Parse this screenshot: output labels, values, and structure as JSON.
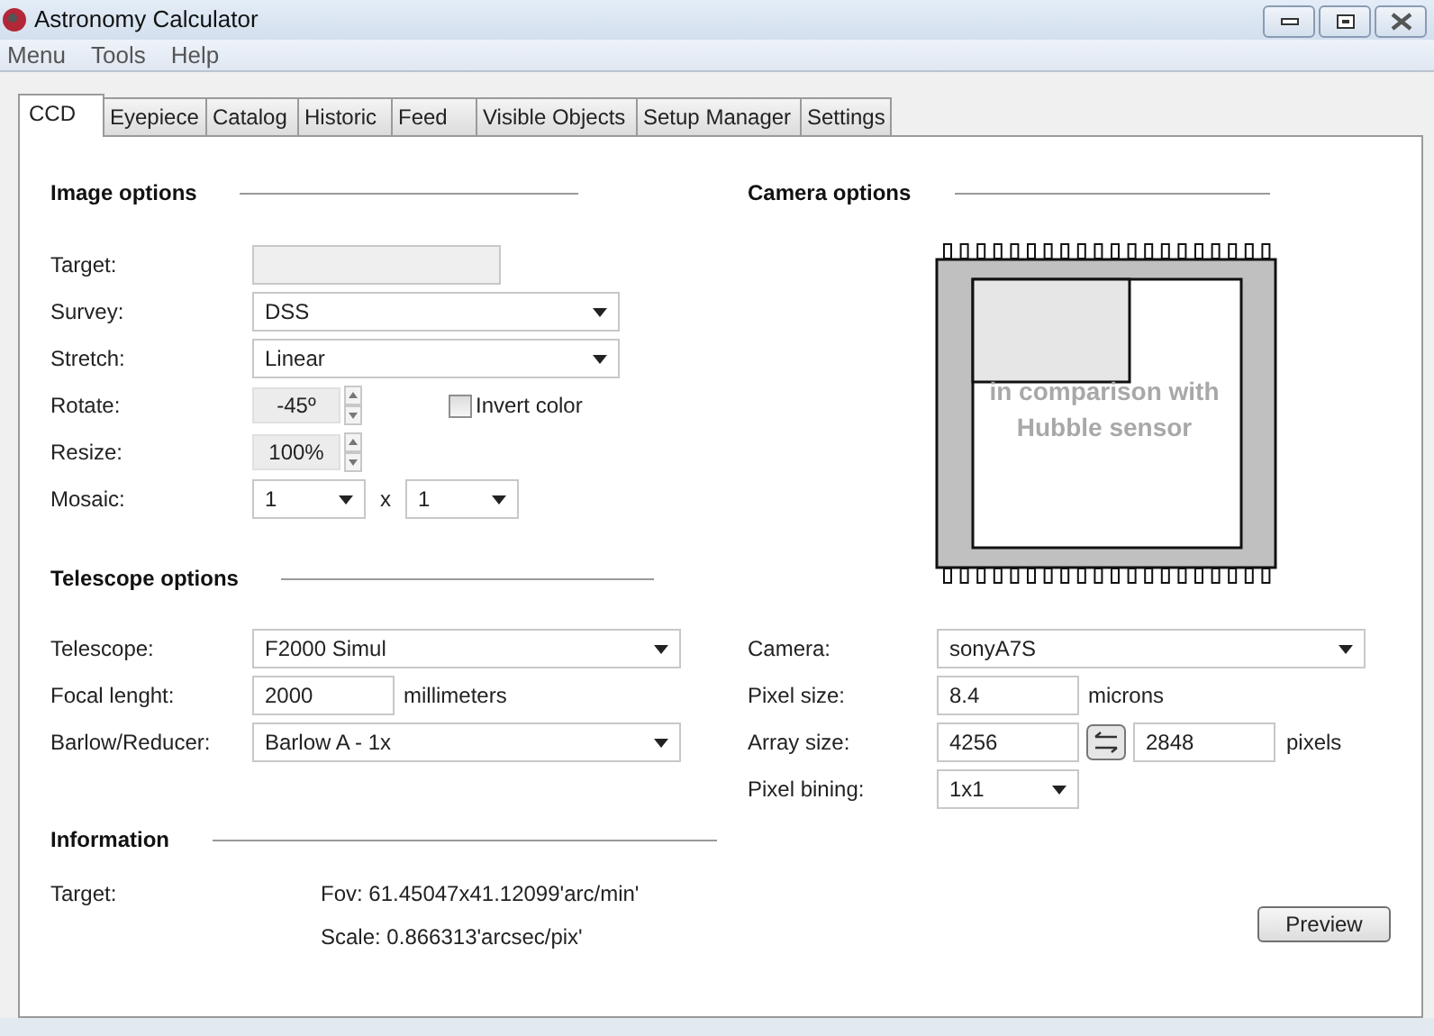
{
  "window": {
    "title": "Astronomy Calculator"
  },
  "menu": [
    "Menu",
    "Tools",
    "Help"
  ],
  "tabs": [
    {
      "label": "CCD",
      "selected": true
    },
    {
      "label": "Eyepiece",
      "selected": false
    },
    {
      "label": "Catalog",
      "selected": false
    },
    {
      "label": "Historic",
      "selected": false
    },
    {
      "label": "Feed",
      "selected": false
    },
    {
      "label": "Visible Objects",
      "selected": false
    },
    {
      "label": "Setup Manager",
      "selected": false
    },
    {
      "label": "Settings",
      "selected": false
    }
  ],
  "image_options": {
    "title": "Image options",
    "fields": [
      {
        "kind": "input",
        "label": "Target:",
        "disabled": true
      },
      {
        "kind": "select",
        "label": "Survey:",
        "value": "DSS"
      },
      {
        "kind": "select",
        "label": "Stretch:",
        "value": "Linear"
      },
      {
        "kind": "spinner",
        "label": "Rotate:",
        "value": "-45º",
        "checkbox": {
          "label": "Invert color",
          "checked": false
        }
      },
      {
        "kind": "spinner",
        "label": "Resize:",
        "value": "100%"
      },
      {
        "kind": "pair",
        "label": "Mosaic:",
        "values": [
          "1",
          "1"
        ],
        "separator": "x"
      }
    ]
  },
  "telescope_options": {
    "title": "Telescope options",
    "fields": [
      {
        "kind": "select",
        "label": "Telescope:",
        "value": "F2000 Simul"
      },
      {
        "kind": "measure",
        "label": "Focal lenght:",
        "value": "2000",
        "unit": "millimeters"
      },
      {
        "kind": "select",
        "label": "Barlow/Reducer:",
        "value": "Barlow A - 1x"
      }
    ]
  },
  "information": {
    "title": "Information",
    "label": "Target:",
    "lines": [
      "Fov: 61.45047x41.12099'arc/min'",
      "Scale: 0.866313'arcsec/pix'"
    ]
  },
  "camera_options": {
    "title": "Camera options",
    "caption": "in comparison with Hubble sensor",
    "fields": [
      {
        "kind": "select",
        "label": "Camera:",
        "value": "sonyA7S"
      },
      {
        "kind": "measure",
        "label": "Pixel size:",
        "value": "8.4",
        "unit": "microns"
      },
      {
        "kind": "array",
        "label": "Array size:",
        "values": [
          "4256",
          "2848"
        ],
        "unit": "pixels"
      },
      {
        "kind": "small_select",
        "label": "Pixel bining:",
        "value": "1x1"
      }
    ]
  },
  "buttons": [
    "Preview"
  ]
}
